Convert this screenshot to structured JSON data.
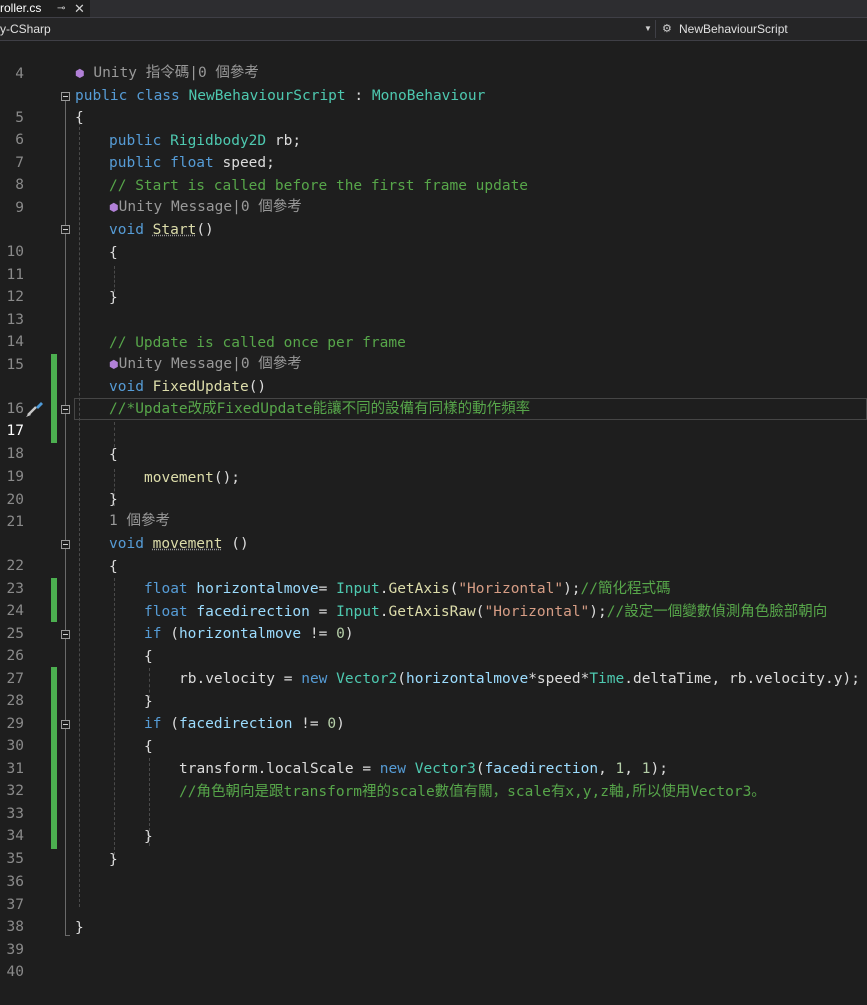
{
  "tab": {
    "name": "roller.cs",
    "pin_icon": "pin-icon",
    "close_icon": "close-icon"
  },
  "nav": {
    "project": "y-CSharp",
    "class_name": "NewBehaviourScript",
    "class_icon": "class-member-icon"
  },
  "codelens": {
    "class": "Unity 指令碼|0 個參考",
    "start": "Unity Message|0 個參考",
    "fixedupdate": "Unity Message|0 個參考",
    "movement": "1 個參考"
  },
  "lines": {
    "l4": "4",
    "l5": "5",
    "l6": "6",
    "l7": "7",
    "l8": "8",
    "l9": "9",
    "l10": "10",
    "l11": "11",
    "l12": "12",
    "l13": "13",
    "l14": "14",
    "l15": "15",
    "l16": "16",
    "l17": "17",
    "l18": "18",
    "l19": "19",
    "l20": "20",
    "l21": "21",
    "l22": "22",
    "l23": "23",
    "l24": "24",
    "l25": "25",
    "l26": "26",
    "l27": "27",
    "l28": "28",
    "l29": "29",
    "l30": "30",
    "l31": "31",
    "l32": "32",
    "l33": "33",
    "l34": "34",
    "l35": "35",
    "l36": "36",
    "l37": "37",
    "l38": "38",
    "l39": "39",
    "l40": "40"
  },
  "code": {
    "l5_kw": "public class ",
    "l5_name": "NewBehaviourScript",
    "l5_colon": " : ",
    "l5_base": "MonoBehaviour",
    "l6": "{",
    "l7_kw": "public ",
    "l7_type": "Rigidbody2D",
    "l7_rest": " rb;",
    "l8_kw": "public float",
    "l8_rest": " speed;",
    "l9": "// Start is called before the first frame update",
    "l10_kw": "void ",
    "l10_name": "Start",
    "l10_rest": "()",
    "l11": "{",
    "l13": "}",
    "l15": "// Update is called once per frame",
    "l16_kw": "void ",
    "l16_name": "FixedUpdate",
    "l16_rest": "()",
    "l17": "//*Update改成FixedUpdate能讓不同的設備有同樣的動作頻率",
    "l19": "{",
    "l20_name": "movement",
    "l20_rest": "();",
    "l21": "}",
    "l22_kw": "void ",
    "l22_name": "movement",
    "l22_rest": " ()",
    "l23": "{",
    "l24_kw": "float ",
    "l24_var": "horizontalmove",
    "l24_eq": "= ",
    "l24_cls": "Input",
    "l24_dot": ".",
    "l24_fn": "GetAxis",
    "l24_p1": "(",
    "l24_str": "\"Horizontal\"",
    "l24_p2": ");",
    "l24_cm": "//簡化程式碼",
    "l25_kw": "float ",
    "l25_var": "facedirection",
    "l25_eq": " = ",
    "l25_cls": "Input",
    "l25_dot": ".",
    "l25_fn": "GetAxisRaw",
    "l25_p1": "(",
    "l25_str": "\"Horizontal\"",
    "l25_p2": ");",
    "l25_cm": "//設定一個變數偵測角色臉部朝向",
    "l26_kw": "if",
    "l26_p1": " (",
    "l26_var": "horizontalmove",
    "l26_op": " != ",
    "l26_num": "0",
    "l26_p2": ")",
    "l27": "{",
    "l28_a": "rb.velocity = ",
    "l28_kw": "new ",
    "l28_type": "Vector2",
    "l28_b": "(",
    "l28_var": "horizontalmove",
    "l28_c": "*speed*",
    "l28_cls": "Time",
    "l28_d": ".deltaTime, rb.velocity.y);",
    "l29": "}",
    "l30_kw": "if",
    "l30_p1": " (",
    "l30_var": "facedirection",
    "l30_op": " != ",
    "l30_num": "0",
    "l30_p2": ")",
    "l31": "{",
    "l32_a": "transform.localScale = ",
    "l32_kw": "new ",
    "l32_type": "Vector3",
    "l32_b": "(",
    "l32_var": "facedirection",
    "l32_c": ", ",
    "l32_n1": "1",
    "l32_d": ", ",
    "l32_n2": "1",
    "l32_e": ");",
    "l33": "//角色朝向是跟transform裡的scale數值有關，scale有x,y,z軸,所以使用Vector3。",
    "l35": "}",
    "l36": "}",
    "l39": "}"
  }
}
